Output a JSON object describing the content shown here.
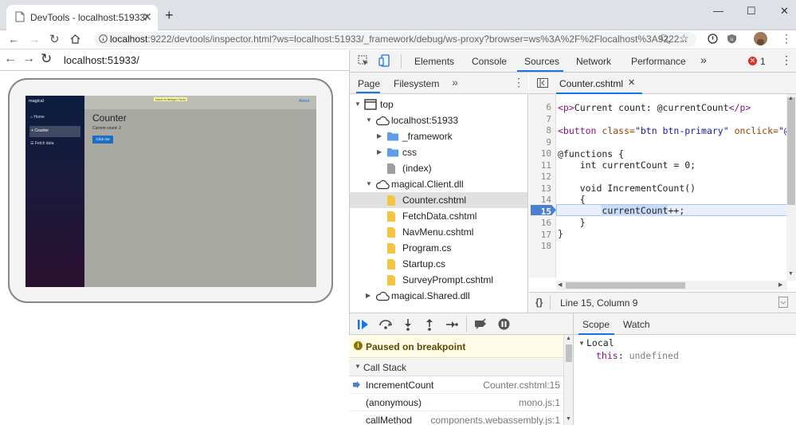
{
  "browser": {
    "tab_title": "DevTools - localhost:51933/",
    "url_host": "localhost",
    "url_rest": ":9222/devtools/inspector.html?ws=localhost:51933/_framework/debug/ws-proxy?browser=ws%3A%2F%2Flocalhost%3A9222..."
  },
  "page": {
    "url": "localhost:51933/",
    "app": {
      "brand": "magical",
      "about": "About",
      "banner": "Issue in design / todo",
      "nav": [
        "Home",
        "Counter",
        "Fetch data"
      ],
      "heading": "Counter",
      "count_text": "Current count: 2",
      "button": "Click me"
    }
  },
  "devtools": {
    "tabs": [
      "Elements",
      "Console",
      "Sources",
      "Network",
      "Performance"
    ],
    "active_tab": "Sources",
    "error_count": "1",
    "navigator_tabs": [
      "Page",
      "Filesystem"
    ],
    "tree": [
      {
        "label": "top",
        "icon": "frame-icon",
        "depth": 0
      },
      {
        "label": "localhost:51933",
        "icon": "cloud-icon",
        "depth": 1
      },
      {
        "label": "_framework",
        "icon": "folder-icon",
        "depth": 2
      },
      {
        "label": "css",
        "icon": "folder-icon",
        "depth": 2
      },
      {
        "label": "(index)",
        "icon": "file-gray-icon",
        "depth": 2
      },
      {
        "label": "magical.Client.dll",
        "icon": "cloud-icon",
        "depth": 1
      },
      {
        "label": "Counter.cshtml",
        "icon": "file-icon",
        "depth": 2
      },
      {
        "label": "FetchData.cshtml",
        "icon": "file-icon",
        "depth": 2
      },
      {
        "label": "NavMenu.cshtml",
        "icon": "file-icon",
        "depth": 2
      },
      {
        "label": "Program.cs",
        "icon": "file-icon",
        "depth": 2
      },
      {
        "label": "Startup.cs",
        "icon": "file-icon",
        "depth": 2
      },
      {
        "label": "SurveyPrompt.cshtml",
        "icon": "file-icon",
        "depth": 2
      },
      {
        "label": "magical.Shared.dll",
        "icon": "cloud-icon",
        "depth": 1
      }
    ],
    "editor_tab": "Counter.cshtml",
    "code": {
      "line_numbers": [
        "6",
        "7",
        "8",
        "9",
        "10",
        "11",
        "12",
        "13",
        "14",
        "15",
        "16",
        "17",
        "18"
      ],
      "line6_tag_open": "<p>",
      "line6_text": "Current count: @currentCount",
      "line6_tag_close": "</p>",
      "line8_tag": "<button",
      "line8_attr1": " class=",
      "line8_val1": "\"btn btn-primary\"",
      "line8_attr2": " onclick=",
      "line8_val2": "\"@In",
      "line10": "@functions {",
      "line11": "    int currentCount = 0;",
      "line13": "    void IncrementCount()",
      "line14": "    {",
      "line15_var": "currentCount",
      "line15_rest": "++;",
      "line16": "    }",
      "line17": "}"
    },
    "current_line": "15",
    "status": "Line 15, Column 9",
    "paused_text": "Paused on breakpoint",
    "call_stack_title": "Call Stack",
    "call_stack": [
      {
        "fn": "IncrementCount",
        "loc": "Counter.cshtml:15"
      },
      {
        "fn": "(anonymous)",
        "loc": "mono.js:1"
      },
      {
        "fn": "callMethod",
        "loc": "components.webassembly.js:1"
      }
    ],
    "scope_tabs": [
      "Scope",
      "Watch"
    ],
    "scope": {
      "section": "Local",
      "var": "this",
      "sep": ": ",
      "value": "undefined"
    }
  }
}
